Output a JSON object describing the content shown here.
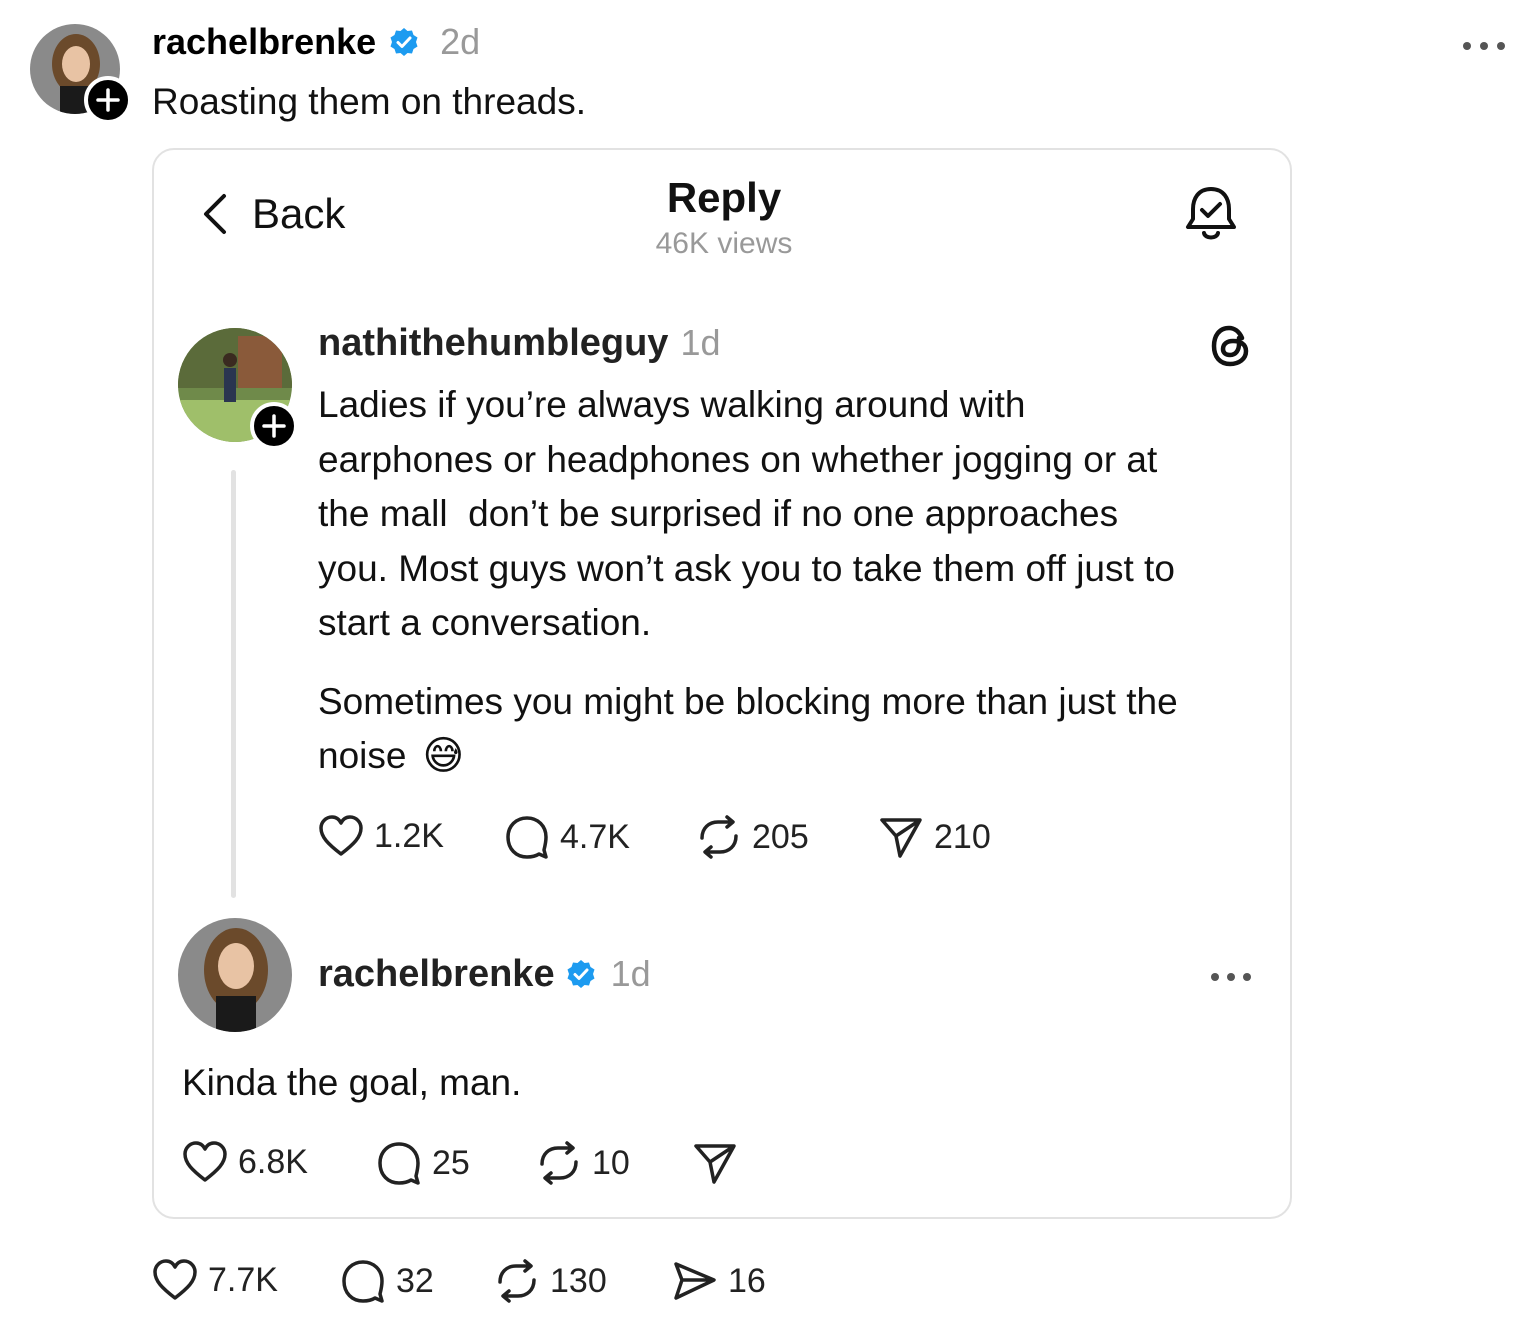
{
  "post": {
    "author": "rachelbrenke",
    "time": "2d",
    "text": "Roasting them on threads.",
    "metrics": {
      "likes": "7.7K",
      "replies": "32",
      "reposts": "130",
      "shares": "16"
    }
  },
  "screenshot": {
    "back_label": "Back",
    "title": "Reply",
    "views": "46K views",
    "original": {
      "author": "nathithehumbleguy",
      "time": "1d",
      "lines": [
        "Ladies if you’re always walking around with",
        "earphones or headphones on whether jogging or at",
        "the mall  don’t be surprised if no one approaches",
        "you. Most guys won’t ask you to take them off just to",
        "start a conversation."
      ],
      "line2a": "Sometimes you might be blocking more than just the",
      "line2b": "noise",
      "emoji": "😅",
      "metrics": {
        "likes": "1.2K",
        "replies": "4.7K",
        "reposts": "205",
        "shares": "210"
      }
    },
    "reply": {
      "author": "rachelbrenke",
      "time": "1d",
      "text": "Kinda the goal, man.",
      "metrics": {
        "likes": "6.8K",
        "replies": "25",
        "reposts": "10"
      }
    }
  },
  "colors": {
    "verified": "#1d9bf0",
    "muted": "#999999",
    "border": "#e2e2e2"
  },
  "icons": [
    "heart-icon",
    "comment-icon",
    "repost-icon",
    "share-icon",
    "bell-check-icon",
    "threads-logo-icon",
    "more-icon",
    "back-chevron-icon",
    "plus-icon",
    "verified-badge-icon"
  ]
}
